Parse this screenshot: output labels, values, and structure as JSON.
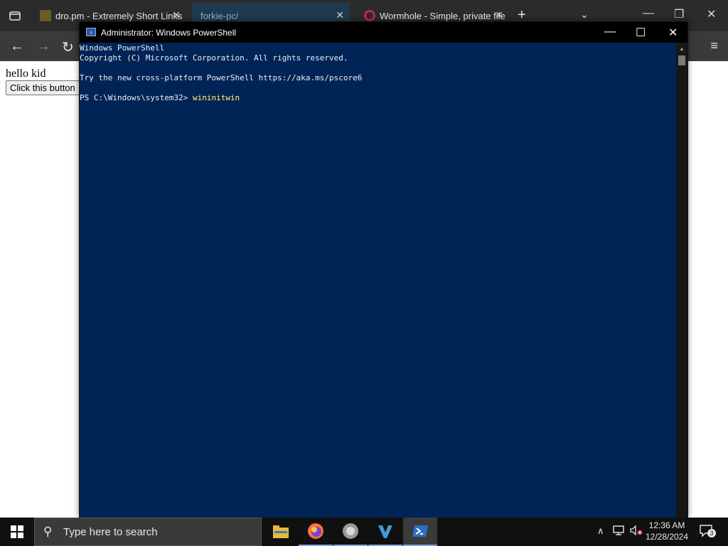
{
  "browser": {
    "tabs": [
      {
        "title": "dro.pm - Extremely Short Links",
        "close": "✕",
        "active": false
      },
      {
        "title": "forkie-pc/",
        "close": "✕",
        "active": true
      },
      {
        "title": "Wormhole - Simple, private file",
        "close": "✕",
        "active": false
      }
    ],
    "new_tab": "+",
    "tabs_dropdown": "⌄",
    "window_controls": {
      "minimize": "—",
      "restore": "❐",
      "close": "✕"
    },
    "nav": {
      "back": "←",
      "forward": "→",
      "reload": "↻",
      "menu": "≡"
    }
  },
  "page": {
    "hello_text": "hello kid",
    "button_label": "Click this button"
  },
  "powershell": {
    "title": "Administrator: Windows PowerShell",
    "icon": "powershell-icon",
    "controls": {
      "minimize": "—",
      "maximize": "☐",
      "close": "✕"
    },
    "lines": [
      "Windows PowerShell",
      "Copyright (C) Microsoft Corporation. All rights reserved.",
      "",
      "Try the new cross-platform PowerShell https://aka.ms/pscore6",
      ""
    ],
    "prompt": "PS C:\\Windows\\system32> ",
    "command": "wininitwin",
    "colors": {
      "background": "#012456",
      "text": "#eeedf0",
      "command": "#ffff60"
    }
  },
  "taskbar": {
    "search_placeholder": "Type here to search",
    "search_icon": "⚲",
    "apps": [
      "file-explorer-icon",
      "firefox-icon",
      "app-icon",
      "visual-studio-icon",
      "powershell-icon"
    ],
    "tray": {
      "chevron": "∧"
    },
    "clock": {
      "time": "12:36 AM",
      "date": "12/28/2024"
    },
    "notifications_count": "3"
  }
}
